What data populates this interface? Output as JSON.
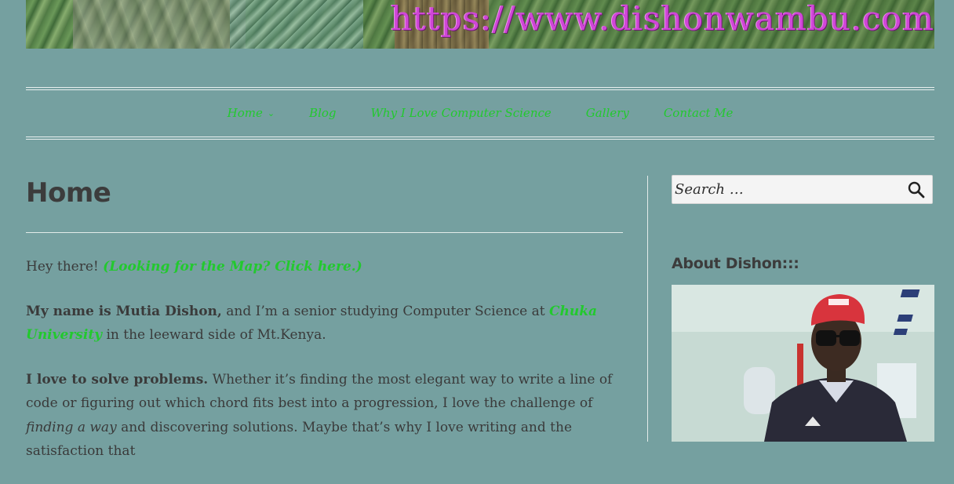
{
  "header": {
    "banner_url": "https://www.dishonwambu.com"
  },
  "nav": {
    "items": [
      {
        "label": "Home",
        "has_dropdown": true
      },
      {
        "label": "Blog"
      },
      {
        "label": "Why I Love Computer Science"
      },
      {
        "label": "Gallery"
      },
      {
        "label": "Contact Me"
      }
    ]
  },
  "page": {
    "title": "Home",
    "p1": {
      "text": "Hey there! ",
      "link": "(Looking for the Map? Click here.)"
    },
    "p2": {
      "bold": "My name is Mutia Dishon,",
      "text1": " and I’m a senior studying Computer Science at ",
      "link": "Chuka University",
      "text2": " in the leeward side of Mt.Kenya."
    },
    "p3": {
      "bold": "I love to solve problems.",
      "text1": " Whether it’s finding the most elegant way to write a line of code or figuring out which chord fits best into a progression, I love the challenge of ",
      "italic": "finding a way",
      "text2": " and discovering solutions. Maybe that’s why I love writing and the satisfaction that"
    }
  },
  "sidebar": {
    "search_placeholder": "Search …",
    "about_title": "About Dishon:::"
  },
  "colors": {
    "background": "#75a0a0",
    "link_green": "#22c92e",
    "banner_magenta": "#d046d7"
  }
}
